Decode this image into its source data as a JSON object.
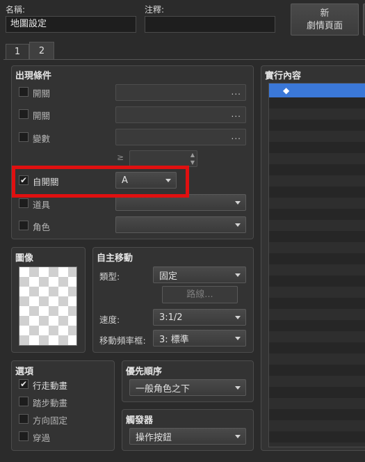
{
  "header": {
    "name_label": "名稱:",
    "name_value": "地圖設定",
    "note_label": "注釋:",
    "note_value": "",
    "new_page_button": "新\n劇情頁面"
  },
  "tabs": [
    {
      "label": "1"
    },
    {
      "label": "2"
    }
  ],
  "conditions": {
    "title": "出現條件",
    "switch1": {
      "label": "開關",
      "value": "...",
      "checked": false
    },
    "switch2": {
      "label": "開關",
      "value": "...",
      "checked": false
    },
    "variable": {
      "label": "變數",
      "value": "...",
      "checked": false
    },
    "ge_symbol": "≥",
    "self_switch": {
      "label": "自開關",
      "value": "A",
      "checked": true
    },
    "item": {
      "label": "道具",
      "checked": false
    },
    "actor": {
      "label": "角色",
      "checked": false
    }
  },
  "image_panel": {
    "title": "圖像"
  },
  "autonomous": {
    "title": "自主移動",
    "type_label": "類型:",
    "type_value": "固定",
    "route_button": "路線...",
    "speed_label": "速度:",
    "speed_value": "3:1/2",
    "freq_label": "移動頻率框:",
    "freq_value": "3: 標準"
  },
  "options": {
    "title": "選項",
    "items": [
      {
        "label": "行走動畫",
        "checked": true
      },
      {
        "label": "踏步動畫",
        "checked": false
      },
      {
        "label": "方向固定",
        "checked": false
      },
      {
        "label": "穿過",
        "checked": false
      }
    ]
  },
  "priority": {
    "title": "優先順序",
    "value": "一般角色之下"
  },
  "trigger": {
    "title": "觸發器",
    "value": "操作按鈕"
  },
  "contents": {
    "title": "實行內容",
    "first_item": "◆"
  },
  "colors": {
    "highlight_border": "#e01010",
    "selected_row": "#3b78d8",
    "background": "#2b2b2b"
  }
}
